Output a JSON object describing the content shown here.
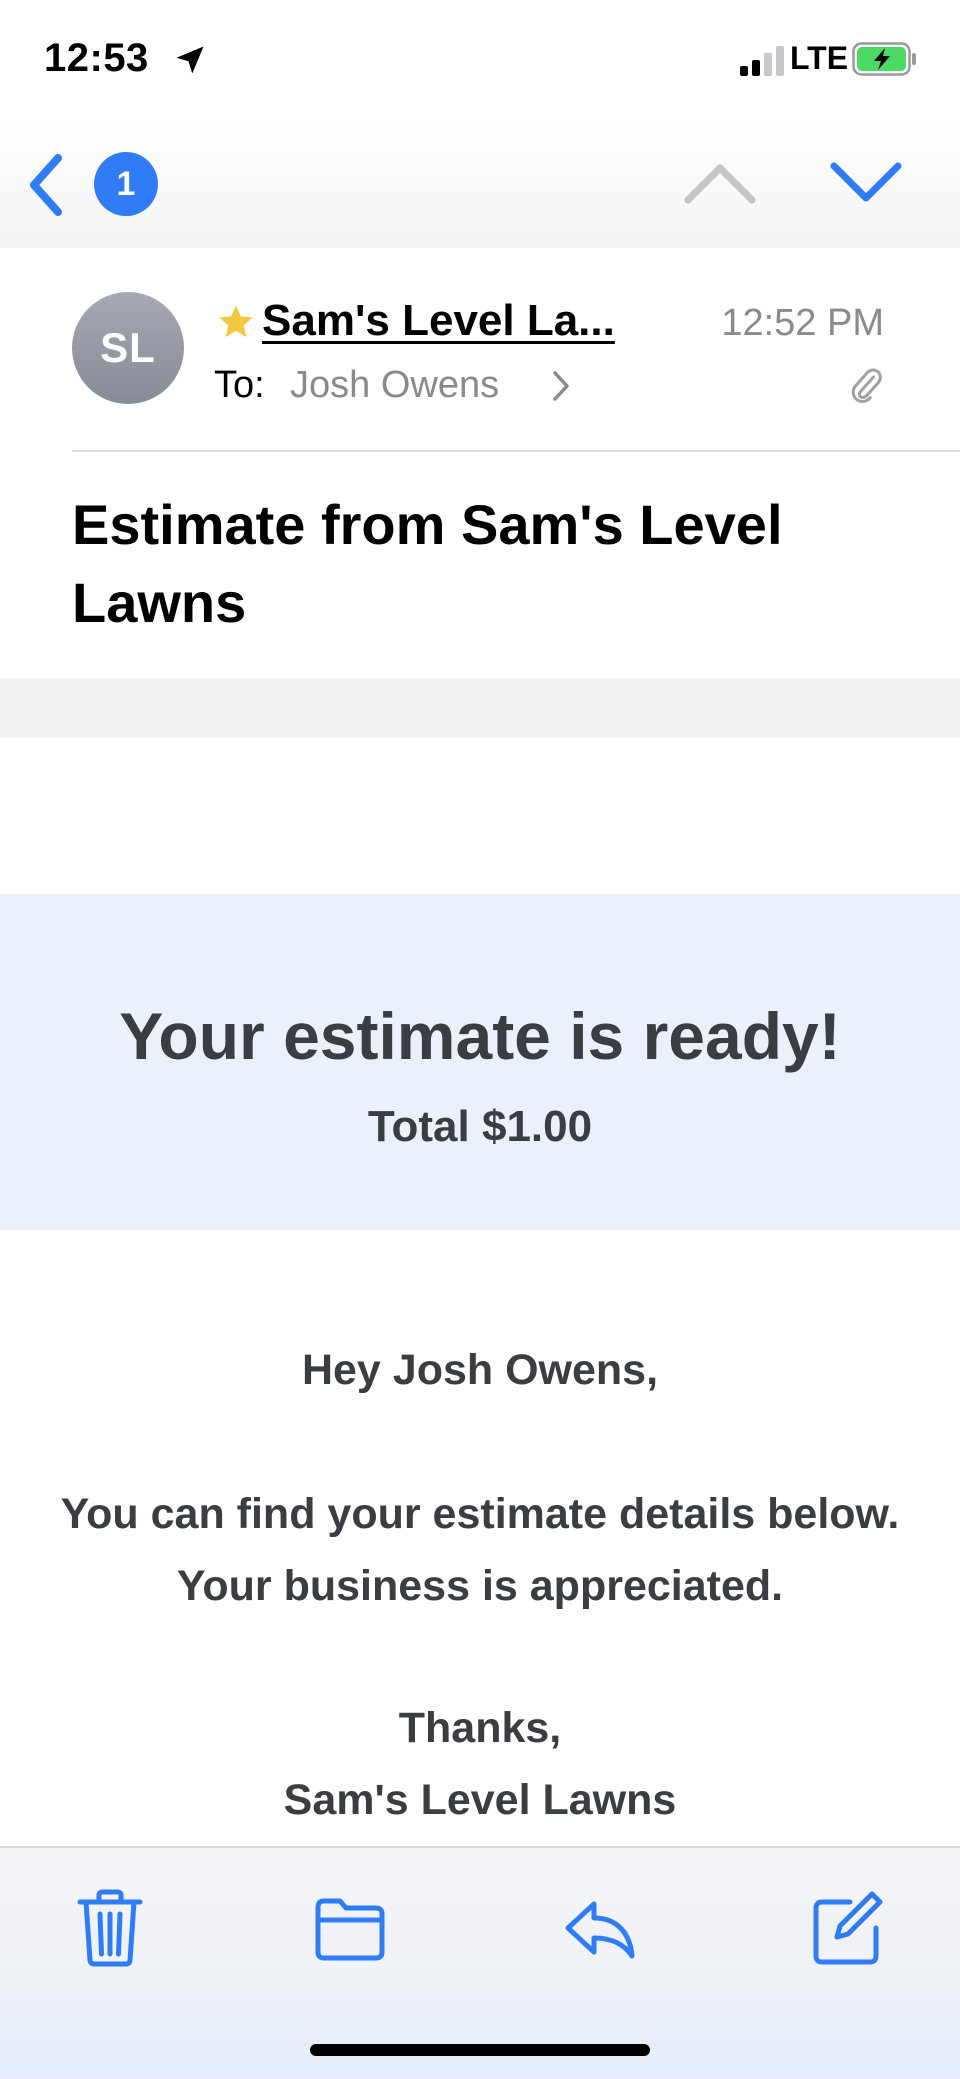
{
  "status_bar": {
    "time": "12:53",
    "network": "LTE",
    "icons": [
      "location-arrow-icon",
      "signal-bars-icon",
      "battery-charging-icon"
    ]
  },
  "nav": {
    "unread_count": "1",
    "icons": [
      "chevron-left-icon",
      "chevron-up-icon",
      "chevron-down-icon"
    ]
  },
  "header": {
    "avatar_initials": "SL",
    "sender": "Sam's Level La...",
    "time": "12:52 PM",
    "to_label": "To:",
    "to_name": "Josh Owens",
    "subject": "Estimate from Sam's Level Lawns"
  },
  "body": {
    "hero_title": "Your estimate is ready!",
    "hero_total": "Total $1.00",
    "greeting": "Hey Josh Owens,",
    "line1": "You can find your estimate details below.",
    "line2": "Your business is appreciated.",
    "thanks": "Thanks,",
    "signature": "Sam's Level Lawns"
  },
  "toolbar": {
    "icons": [
      "trash-icon",
      "folder-icon",
      "reply-icon",
      "compose-icon"
    ]
  },
  "colors": {
    "accent": "#2f7cf6",
    "star": "#f5c842",
    "hero_bg": "#eaf1fa",
    "body_text": "#3a3d42",
    "muted": "#8a8a8e",
    "battery": "#4cd964"
  }
}
